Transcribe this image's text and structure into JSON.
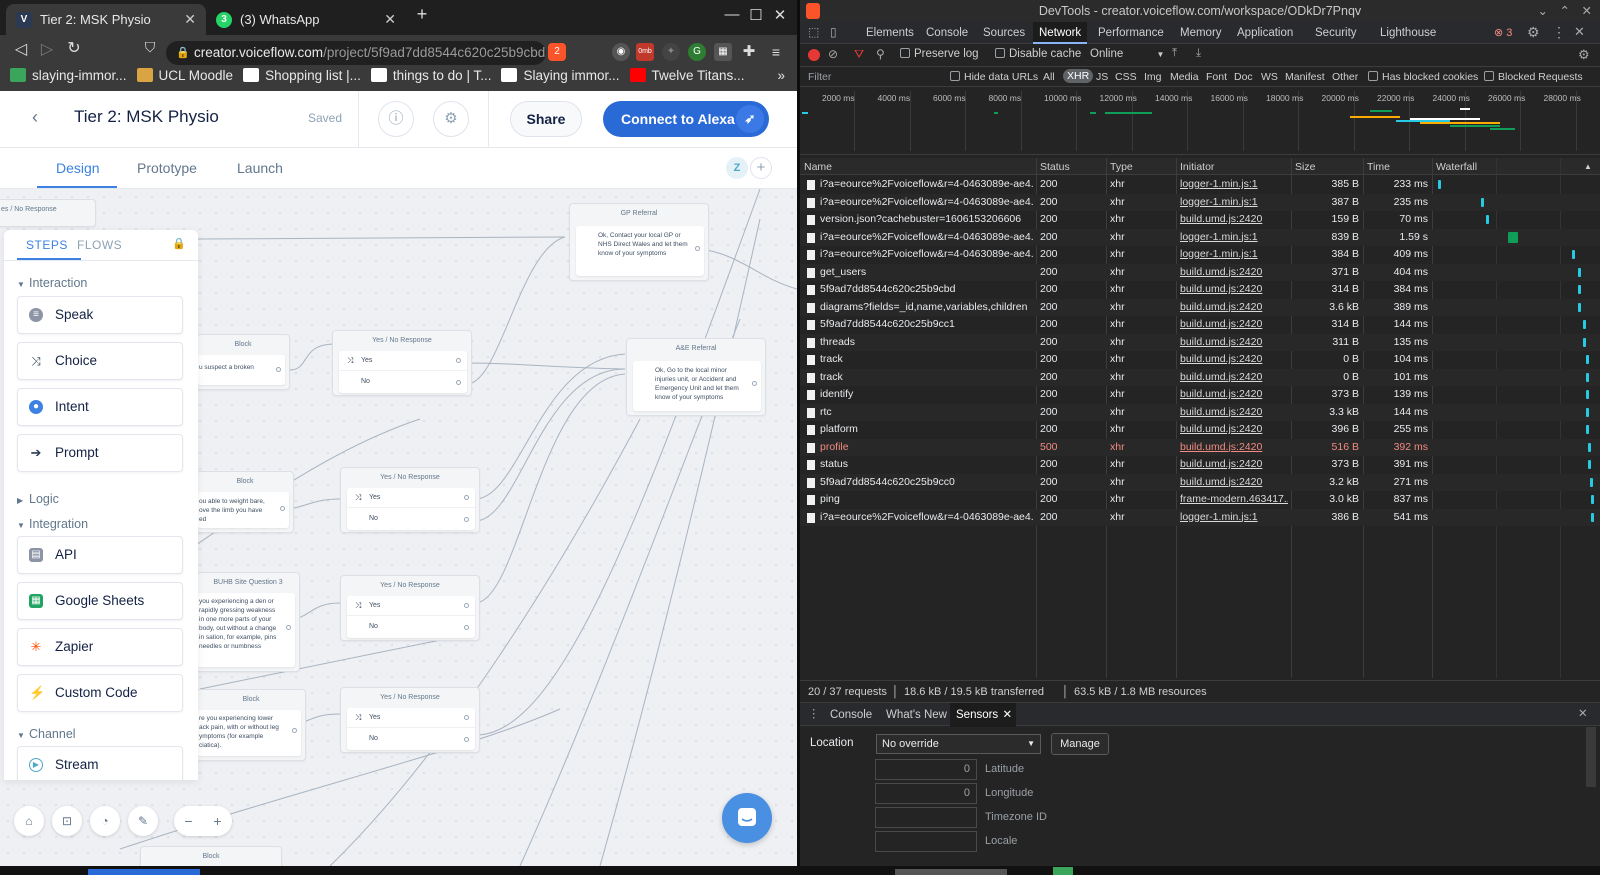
{
  "browser": {
    "tabs": [
      {
        "title": "Tier 2: MSK Physio",
        "icon": "voiceflow-logo",
        "active": true
      },
      {
        "title": "(3) WhatsApp",
        "icon": "whatsapp-logo",
        "active": false
      }
    ],
    "new_tab": "+",
    "url_host": "creator.voiceflow.com",
    "url_path": "/project/5f9ad7dd8544c620c25b9cbd/c...",
    "brave_badge": "2",
    "ext_badge": "0mb",
    "bookmarks": [
      {
        "label": "slaying-immor...",
        "color": "#3ba55c"
      },
      {
        "label": "UCL Moodle",
        "color": "#d9a441"
      },
      {
        "label": "Shopping list |...",
        "color": "#ffffff"
      },
      {
        "label": "things to do | T...",
        "color": "#ffffff"
      },
      {
        "label": "Slaying immor...",
        "color": "#ffffff"
      },
      {
        "label": "Twelve Titans...",
        "color": "#ff0000"
      }
    ],
    "bookmarks_more": "»"
  },
  "voiceflow": {
    "project_title": "Tier 2: MSK Physio",
    "saved_status": "Saved",
    "share_label": "Share",
    "connect_label": "Connect to Alexa",
    "tabs": [
      "Design",
      "Prototype",
      "Launch"
    ],
    "avatar_initial": "Z",
    "panel": {
      "tab_steps": "STEPS",
      "tab_flows": "FLOWS",
      "sections": {
        "interaction": "Interaction",
        "logic": "Logic",
        "integration": "Integration",
        "channel": "Channel"
      },
      "interaction_steps": [
        {
          "label": "Speak",
          "icon": "speak-icon",
          "color": "#8c94a6"
        },
        {
          "label": "Choice",
          "icon": "choice-icon",
          "color": "#2b3a52"
        },
        {
          "label": "Intent",
          "icon": "intent-icon",
          "color": "#3d82e2"
        },
        {
          "label": "Prompt",
          "icon": "prompt-icon",
          "color": "#2b3a52"
        }
      ],
      "integration_steps": [
        {
          "label": "API",
          "icon": "api-icon",
          "color": "#8c94a6"
        },
        {
          "label": "Google Sheets",
          "icon": "google-sheets-icon",
          "color": "#22a463"
        },
        {
          "label": "Zapier",
          "icon": "zapier-icon",
          "color": "#ff4a00"
        },
        {
          "label": "Custom Code",
          "icon": "custom-code-icon",
          "color": "#f5b82e"
        }
      ],
      "channel_steps": [
        {
          "label": "Stream",
          "icon": "stream-icon",
          "color": "#4fa9c8"
        }
      ]
    },
    "canvas": {
      "nodes": {
        "top_left_title": "es / No Response",
        "gp_title": "GP Referral",
        "gp_text": "Ok, Contact your local GP or NHS Direct Wales and let them know of your symptoms",
        "ae_title": "A&E Referral",
        "ae_text": "Ok, Go to the local minor injuries unit, or Accident and Emergency Unit and let them know of your symptoms",
        "block1_title": "Block",
        "block1_text": "u suspect a broken",
        "block2_title": "Block",
        "block2_text": "ou able to weight bare, ove the limb you have ed",
        "block3_title": "BUHB Site Question 3",
        "block3_text": "you experiencing a den or rapidly gressing weakness in one more parts of your body, out without a change in sation, for example, pins needles or numbness",
        "block4_title": "Block",
        "block4_text": "re you experiencing lower ack pain, with or without leg ymptoms (for example ciatica).",
        "block5_title": "Block",
        "yn_title": "Yes / No Response",
        "yes": "Yes",
        "no": "No"
      }
    }
  },
  "devtools": {
    "window_title": "DevTools - creator.voiceflow.com/workspace/ODkDr7Pnqv",
    "tabs": [
      "Elements",
      "Console",
      "Sources",
      "Network",
      "Performance",
      "Memory",
      "Application",
      "Security",
      "Lighthouse"
    ],
    "active_tab": "Network",
    "error_count": "3",
    "toolbar": {
      "preserve_log": "Preserve log",
      "disable_cache": "Disable cache",
      "throttle": "Online"
    },
    "filter": {
      "placeholder": "Filter",
      "hide_data_urls": "Hide data URLs",
      "types": [
        "All",
        "XHR",
        "JS",
        "CSS",
        "Img",
        "Media",
        "Font",
        "Doc",
        "WS",
        "Manifest",
        "Other"
      ],
      "active_type": "XHR",
      "has_blocked_cookies": "Has blocked cookies",
      "blocked_requests": "Blocked Requests"
    },
    "timeline_ticks": [
      "2000 ms",
      "4000 ms",
      "6000 ms",
      "8000 ms",
      "10000 ms",
      "12000 ms",
      "14000 ms",
      "16000 ms",
      "18000 ms",
      "20000 ms",
      "22000 ms",
      "24000 ms",
      "26000 ms",
      "28000 ms"
    ],
    "columns": [
      "Name",
      "Status",
      "Type",
      "Initiator",
      "Size",
      "Time",
      "Waterfall"
    ],
    "requests": [
      {
        "name": "i?a=eource%2Fvoiceflow&r=4-0463089e-ae4...",
        "status": "200",
        "type": "xhr",
        "initiator": "logger-1.min.js:1",
        "size": "385 B",
        "time": "233 ms",
        "wf": 0.01
      },
      {
        "name": "i?a=eource%2Fvoiceflow&r=4-0463089e-ae4...",
        "status": "200",
        "type": "xhr",
        "initiator": "logger-1.min.js:1",
        "size": "387 B",
        "time": "235 ms",
        "wf": 0.28
      },
      {
        "name": "version.json?cachebuster=1606153206606",
        "status": "200",
        "type": "xhr",
        "initiator": "build.umd.js:2420",
        "size": "159 B",
        "time": "70 ms",
        "wf": 0.31
      },
      {
        "name": "i?a=eource%2Fvoiceflow&r=4-0463089e-ae4...",
        "status": "200",
        "type": "xhr",
        "initiator": "logger-1.min.js:1",
        "size": "839 B",
        "time": "1.59 s",
        "wf": 0.45
      },
      {
        "name": "i?a=eource%2Fvoiceflow&r=4-0463089e-ae4...",
        "status": "200",
        "type": "xhr",
        "initiator": "logger-1.min.js:1",
        "size": "384 B",
        "time": "409 ms",
        "wf": 0.85
      },
      {
        "name": "get_users",
        "status": "200",
        "type": "xhr",
        "initiator": "build.umd.js:2420",
        "size": "371 B",
        "time": "404 ms",
        "wf": 0.89
      },
      {
        "name": "5f9ad7dd8544c620c25b9cbd",
        "status": "200",
        "type": "xhr",
        "initiator": "build.umd.js:2420",
        "size": "314 B",
        "time": "384 ms",
        "wf": 0.89
      },
      {
        "name": "diagrams?fields=_id,name,variables,children",
        "status": "200",
        "type": "xhr",
        "initiator": "build.umd.js:2420",
        "size": "3.6 kB",
        "time": "389 ms",
        "wf": 0.89
      },
      {
        "name": "5f9ad7dd8544c620c25b9cc1",
        "status": "200",
        "type": "xhr",
        "initiator": "build.umd.js:2420",
        "size": "314 B",
        "time": "144 ms",
        "wf": 0.92
      },
      {
        "name": "threads",
        "status": "200",
        "type": "xhr",
        "initiator": "build.umd.js:2420",
        "size": "311 B",
        "time": "135 ms",
        "wf": 0.92
      },
      {
        "name": "track",
        "status": "200",
        "type": "xhr",
        "initiator": "build.umd.js:2420",
        "size": "0 B",
        "time": "104 ms",
        "wf": 0.94
      },
      {
        "name": "track",
        "status": "200",
        "type": "xhr",
        "initiator": "build.umd.js:2420",
        "size": "0 B",
        "time": "101 ms",
        "wf": 0.94
      },
      {
        "name": "identify",
        "status": "200",
        "type": "xhr",
        "initiator": "build.umd.js:2420",
        "size": "373 B",
        "time": "139 ms",
        "wf": 0.94
      },
      {
        "name": "rtc",
        "status": "200",
        "type": "xhr",
        "initiator": "build.umd.js:2420",
        "size": "3.3 kB",
        "time": "144 ms",
        "wf": 0.94
      },
      {
        "name": "platform",
        "status": "200",
        "type": "xhr",
        "initiator": "build.umd.js:2420",
        "size": "396 B",
        "time": "255 ms",
        "wf": 0.94
      },
      {
        "name": "profile",
        "status": "500",
        "type": "xhr",
        "initiator": "build.umd.js:2420",
        "size": "516 B",
        "time": "392 ms",
        "wf": 0.95,
        "error": true
      },
      {
        "name": "status",
        "status": "200",
        "type": "xhr",
        "initiator": "build.umd.js:2420",
        "size": "373 B",
        "time": "391 ms",
        "wf": 0.95
      },
      {
        "name": "5f9ad7dd8544c620c25b9cc0",
        "status": "200",
        "type": "xhr",
        "initiator": "build.umd.js:2420",
        "size": "3.2 kB",
        "time": "271 ms",
        "wf": 0.96
      },
      {
        "name": "ping",
        "status": "200",
        "type": "xhr",
        "initiator": "frame-modern.463417...",
        "size": "3.0 kB",
        "time": "837 ms",
        "wf": 0.97
      },
      {
        "name": "i?a=eource%2Fvoiceflow&r=4-0463089e-ae4...",
        "status": "200",
        "type": "xhr",
        "initiator": "logger-1.min.js:1",
        "size": "386 B",
        "time": "541 ms",
        "wf": 0.97
      }
    ],
    "status_bar": {
      "requests": "20 / 37 requests",
      "transferred": "18.6 kB / 19.5 kB transferred",
      "resources": "63.5 kB / 1.8 MB resources"
    },
    "drawer_tabs": [
      "Console",
      "What's New",
      "Sensors"
    ],
    "sensors": {
      "location_label": "Location",
      "location_value": "No override",
      "manage_label": "Manage",
      "latitude_value": "0",
      "latitude_label": "Latitude",
      "longitude_value": "0",
      "longitude_label": "Longitude",
      "timezone_label": "Timezone ID",
      "locale_label": "Locale"
    }
  }
}
